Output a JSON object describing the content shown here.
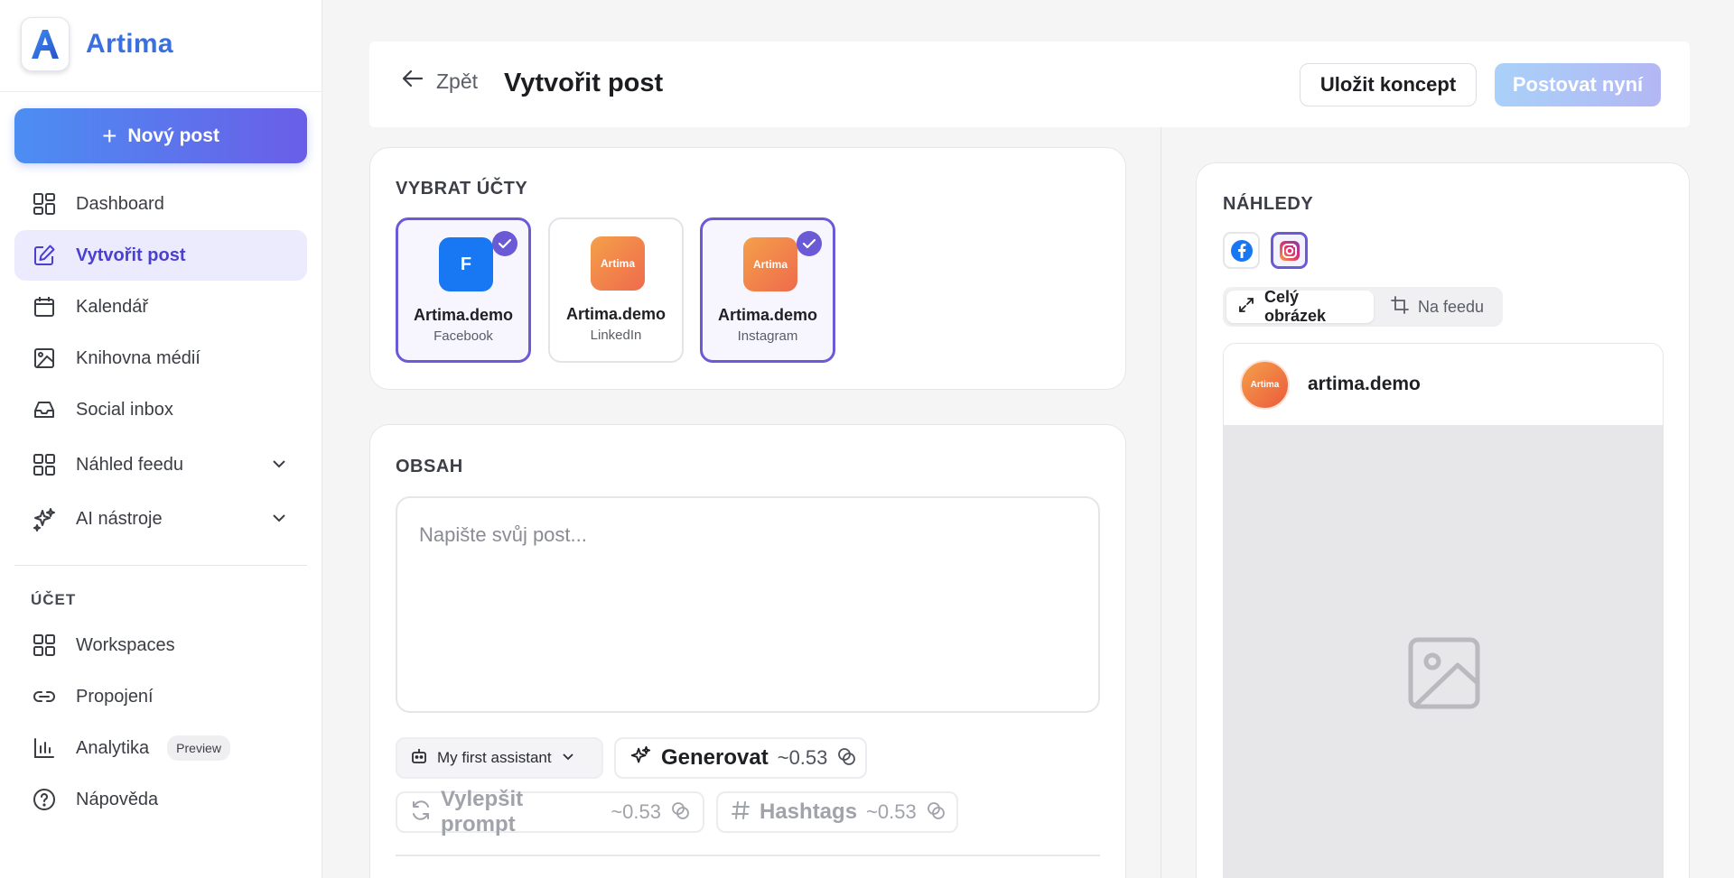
{
  "sidebar": {
    "brand": "Artima",
    "logo_letter": "A",
    "new_post": "Nový post",
    "nav": [
      {
        "label": "Dashboard"
      },
      {
        "label": "Vytvořit post"
      },
      {
        "label": "Kalendář"
      },
      {
        "label": "Knihovna médií"
      },
      {
        "label": "Social inbox"
      },
      {
        "label": "Náhled feedu"
      },
      {
        "label": "AI nástroje"
      }
    ],
    "account_section": "ÚČET",
    "account_nav": [
      {
        "label": "Workspaces"
      },
      {
        "label": "Propojení"
      },
      {
        "label": "Analytika",
        "badge": "Preview"
      },
      {
        "label": "Nápověda"
      }
    ]
  },
  "header": {
    "back": "Zpět",
    "title": "Vytvořit post",
    "save_draft": "Uložit koncept",
    "post_now": "Postovat nyní"
  },
  "accounts": {
    "title": "VYBRAT ÚČTY",
    "items": [
      {
        "name": "Artima.demo",
        "network": "Facebook",
        "avatar_text": "F",
        "selected": true
      },
      {
        "name": "Artima.demo",
        "network": "LinkedIn",
        "avatar_text": "Artima",
        "selected": false
      },
      {
        "name": "Artima.demo",
        "network": "Instagram",
        "avatar_text": "Artima",
        "selected": true
      }
    ]
  },
  "content": {
    "title": "OBSAH",
    "placeholder": "Napište svůj post...",
    "assistant": "My first assistant",
    "generate": "Generovat",
    "generate_cost": "~0.53",
    "improve": "Vylepšit prompt",
    "improve_cost": "~0.53",
    "hashtags": "Hashtags",
    "hashtags_cost": "~0.53"
  },
  "preview": {
    "title": "NÁHLEDY",
    "mode_full": "Celý obrázek",
    "mode_feed": "Na feedu",
    "username": "artima.demo",
    "avatar_text": "Artima"
  },
  "colors": {
    "accent": "#6b5ad6",
    "brand": "#3a6fe0",
    "facebook": "#1877f2"
  }
}
